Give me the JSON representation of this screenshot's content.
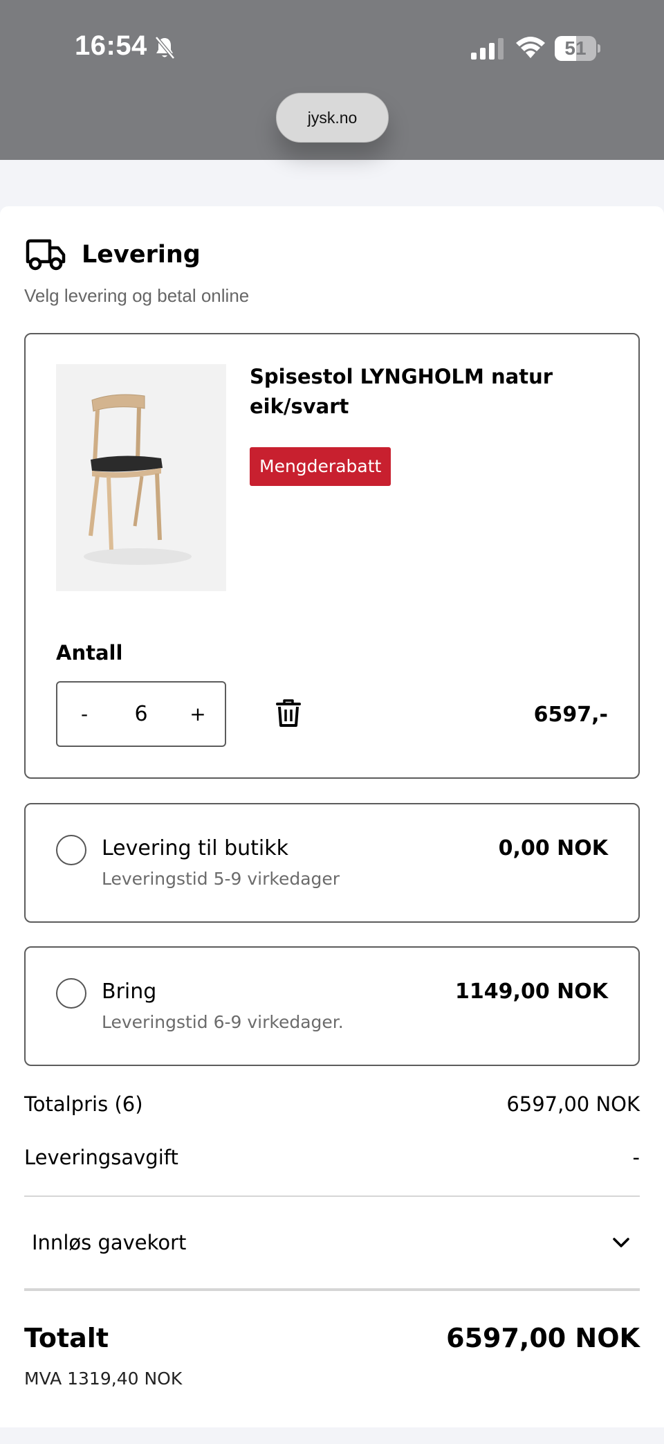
{
  "status_bar": {
    "time": "16:54",
    "battery_percent": "51",
    "battery_level": 0.51,
    "icons": [
      "bell-slash-icon",
      "cellular-signal-icon",
      "wifi-icon",
      "battery-icon"
    ]
  },
  "browser": {
    "url": "jysk.no"
  },
  "delivery": {
    "title": "Levering",
    "title_icon": "truck-icon",
    "subtitle": "Velg levering og betal online"
  },
  "product": {
    "name": "Spisestol LYNGHOLM natur eik/svart",
    "badge": "Mengderabatt",
    "image": "oak-chair-black-seat",
    "quantity_label": "Antall",
    "decrement": "-",
    "quantity": "6",
    "increment": "+",
    "remove_icon": "trash-icon",
    "price": "6597,-"
  },
  "shipping_options": [
    {
      "name": "Levering til butikk",
      "time": "Leveringstid 5-9 virkedager",
      "price": "0,00 NOK",
      "selected": false
    },
    {
      "name": "Bring",
      "time": "Leveringstid 6-9 virkedager.",
      "price": "1149,00 NOK",
      "selected": false
    }
  ],
  "summary": {
    "total_label": "Totalpris (6)",
    "total_value": "6597,00 NOK",
    "fee_label": "Leveringsavgift",
    "fee_value": "-",
    "gift_card_label": "Innløs gavekort",
    "grand_total_label": "Totalt",
    "grand_total_value": "6597,00 NOK",
    "vat": "MVA 1319,40 NOK"
  },
  "colors": {
    "status_bar_bg": "#7b7c7f",
    "page_bg": "#f3f4f8",
    "badge_red": "#c8202f",
    "border": "#5c5c5c",
    "muted_text": "#6b6b6b"
  }
}
